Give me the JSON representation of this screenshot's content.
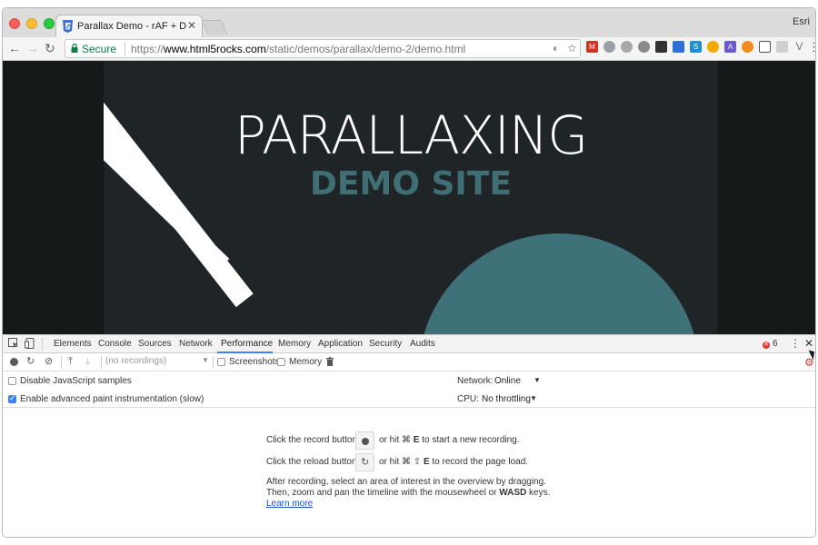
{
  "browser": {
    "tab_title": "Parallax Demo - rAF + DOM + !",
    "profile_name": "Esri",
    "secure_label": "Secure",
    "url": {
      "scheme": "https://",
      "host": "www.html5rocks.com",
      "path": "/static/demos/parallax/demo-2/demo.html"
    },
    "colors": {
      "secure": "#0b8043",
      "tab_bg": "#f4f4f4"
    }
  },
  "page": {
    "hero_title": "PARALLAXING",
    "hero_subtitle": "DEMO SITE",
    "colors": {
      "background": "#1f2527",
      "accent": "#3f7178",
      "title": "#ffffff"
    }
  },
  "devtools": {
    "tabs": [
      "Elements",
      "Console",
      "Sources",
      "Network",
      "Performance",
      "Memory",
      "Application",
      "Security",
      "Audits"
    ],
    "active_tab": "Performance",
    "error_count": "6",
    "recordings_placeholder": "(no recordings)",
    "screenshots_label": "Screenshots",
    "memory_label": "Memory",
    "disable_js_samples_label": "Disable JavaScript samples",
    "paint_instrumentation_label": "Enable advanced paint instrumentation (slow)",
    "network_label": "Network:",
    "network_value": "Online",
    "cpu_label": "CPU:",
    "cpu_value": "No throttling",
    "landing": {
      "record_pre": "Click the record button",
      "record_post_prefix": "or hit ⌘",
      "record_key": "E",
      "record_post": "to start a new recording.",
      "reload_pre": "Click the reload button",
      "reload_post_prefix": "or hit ⌘ ⇧",
      "reload_key": "E",
      "reload_post": "to record the page load.",
      "after_line1": "After recording, select an area of interest in the overview by dragging.",
      "after_line2_pre": "Then, zoom and pan the timeline with the mousewheel or",
      "after_line2_key": "WASD",
      "after_line2_post": "keys.",
      "learn_more": "Learn more"
    },
    "colors": {
      "active_underline": "#3e82f7",
      "error": "#e53935",
      "settings_gear": "#d9302c"
    }
  }
}
